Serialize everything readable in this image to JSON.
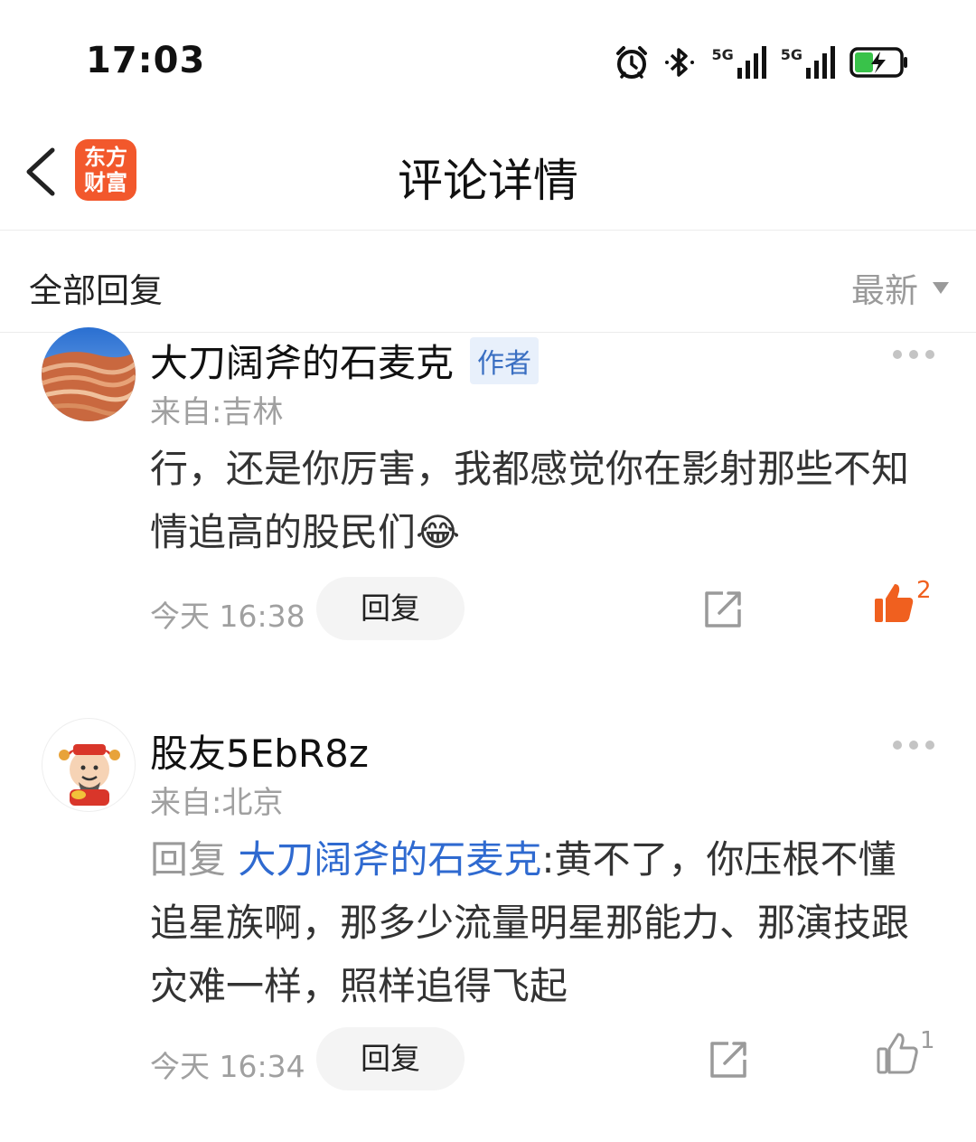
{
  "status_bar": {
    "time": "17:03",
    "network_1": "5G",
    "network_2": "5G"
  },
  "header": {
    "title": "评论详情",
    "logo_line1": "东方",
    "logo_line2": "财富"
  },
  "section": {
    "label": "全部回复",
    "sort_label": "最新"
  },
  "comments": [
    {
      "author": "大刀阔斧的石麦克",
      "tag": "作者",
      "location": "来自:吉林",
      "content": "行，还是你厉害，我都感觉你在影射那些不知情追高的股民们😂",
      "time": "今天 16:38",
      "reply_label": "回复",
      "likes": "2",
      "liked": true,
      "colors": {
        "like_active": "#f0601f"
      }
    },
    {
      "author": "股友5EbR8z",
      "location": "来自:北京",
      "reply_prefix": "回复",
      "reply_target": "大刀阔斧的石麦克",
      "content": ":黄不了，你压根不懂追星族啊，那多少流量明星那能力、那演技跟灾难一样，照样追得飞起",
      "time": "今天 16:34",
      "reply_label": "回复",
      "likes": "1",
      "liked": false
    }
  ]
}
